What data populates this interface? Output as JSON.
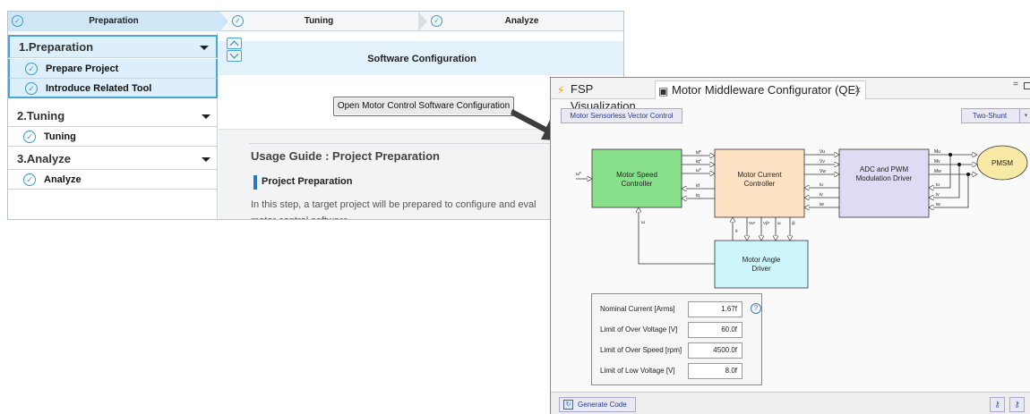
{
  "assistant": {
    "steps": [
      {
        "label": "Preparation",
        "check": "✓"
      },
      {
        "label": "Tuning",
        "check": "✓"
      },
      {
        "label": "Analyze",
        "check": "✓"
      }
    ],
    "sidebar": {
      "sections": [
        {
          "label": "1.Preparation",
          "items": [
            "Prepare Project",
            "Introduce Related Tool"
          ]
        },
        {
          "label": "2.Tuning",
          "items": [
            "Tuning"
          ]
        },
        {
          "label": "3.Analyze",
          "items": [
            "Analyze"
          ]
        }
      ],
      "item_check": "✓"
    },
    "main": {
      "section_title": "Software Configuration",
      "open_button": "Open Motor Control Software Configuration",
      "guide_title": "Usage Guide : Project Preparation",
      "guide_subtitle": "Project Preparation",
      "guide_text_1": "In this step, a target project will be prepared to configure and eval",
      "guide_text_2": "motor control software."
    }
  },
  "configurator": {
    "tabs": [
      {
        "label": "FSP Visualization",
        "icon": "fsp-icon",
        "glyph": "⚡"
      },
      {
        "label": "Motor Middleware Configurator (QE)",
        "icon": "chip-icon",
        "glyph": "▣",
        "close": "×"
      }
    ],
    "window_controls": {
      "minimize": "="
    },
    "control_mode": "Motor Sensorless Vector Control",
    "shunt": {
      "value": "Two-Shunt",
      "caret": "▾"
    },
    "diagram": {
      "blocks": {
        "speed": [
          "Motor Speed",
          "Controller"
        ],
        "current": [
          "Motor Current",
          "Controller"
        ],
        "adc": [
          "ADC and PWM",
          "Modulation Driver"
        ],
        "angle": [
          "Motor Angle",
          "Driver"
        ],
        "pmsm": "PMSM"
      },
      "signals": {
        "omega_ref": "ω*",
        "speed_out": [
          "id*",
          "iq*",
          "ω*",
          "id",
          "iq"
        ],
        "current_out": [
          "Vu",
          "Vv",
          "Vw",
          "iu",
          "iv",
          "iw"
        ],
        "adc_out": [
          "Mu",
          "Mv",
          "Mw",
          "iu",
          "iv",
          "iw"
        ],
        "angle_in": [
          "Vα*",
          "Vβ*",
          "iα",
          "iβ"
        ],
        "theta": "θ",
        "omega_fb": "ω"
      },
      "colors": {
        "speed": "#87e18b",
        "current": "#fde3c4",
        "adc": "#dedcf5",
        "angle": "#ccf6fb",
        "pmsm": "#f8e9a4"
      }
    },
    "params": [
      {
        "label": "Nominal Current [Arms]",
        "value": "1.67f"
      },
      {
        "label": "Limit of Over Voltage [V]",
        "value": "60.0f"
      },
      {
        "label": "Limit of Over Speed [rpm]",
        "value": "4500.0f"
      },
      {
        "label": "Limit of Low Voltage [V]",
        "value": "8.0f"
      }
    ],
    "help_glyph": "?",
    "generate_button": "Generate Code",
    "generate_glyph": "↻",
    "key_glyph": "⚷"
  }
}
